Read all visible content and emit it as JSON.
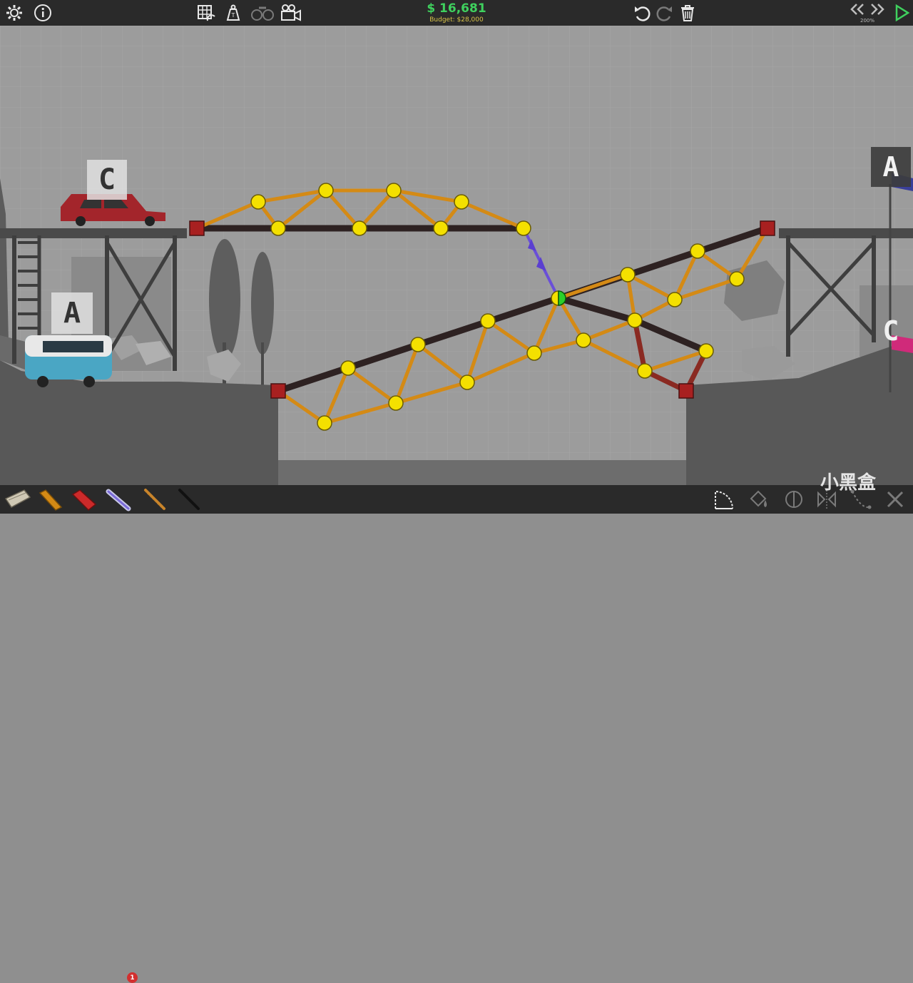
{
  "toolbar": {
    "money": "$ 16,681",
    "budget": "Budget: $28,000",
    "zoom": "200%",
    "icons": [
      "gear-icon",
      "info-icon",
      "grid-icon",
      "weight-icon",
      "binoculars-icon",
      "camera-icon",
      "undo-icon",
      "redo-icon",
      "trash-icon",
      "rewind-icon",
      "fast-forward-icon",
      "play-icon"
    ]
  },
  "scene": {
    "labels": {
      "car_c": "C",
      "van_a": "A",
      "flag_a": "A",
      "flag_c": "C"
    }
  },
  "materials": {
    "badge_count": "1",
    "items": [
      "road-material",
      "wood-material",
      "steel-material",
      "hydraulics-material",
      "rope-material",
      "cable-material"
    ]
  },
  "tools": [
    "arc-tool-icon",
    "paint-icon",
    "split-joint-icon",
    "mirror-icon",
    "chain-icon",
    "close-icon"
  ],
  "watermark": "小黑盒",
  "colors": {
    "wood": "#d48a15",
    "road": "#2e2222",
    "steel": "#8a2a22",
    "joint": "#f4e000",
    "anchor": "#a82020",
    "money": "#3fd15e",
    "budget": "#d9c44a"
  }
}
